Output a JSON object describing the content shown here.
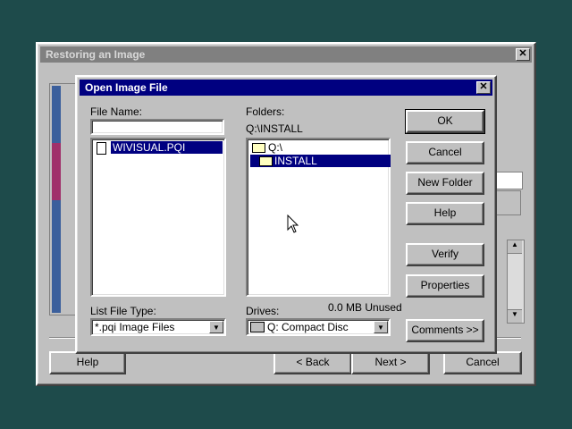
{
  "back_window": {
    "title": "Restoring an Image",
    "buttons": {
      "help": "Help",
      "back": "< Back",
      "next": "Next >",
      "cancel": "Cancel"
    }
  },
  "dialog": {
    "title": "Open Image File",
    "file_name_label": "File Name:",
    "file_name_value": "",
    "files": [
      "WIVISUAL.PQI"
    ],
    "list_file_type_label": "List File Type:",
    "list_file_type_value": "*.pqi  Image Files",
    "folders_label": "Folders:",
    "current_path": "Q:\\INSTALL",
    "folders": [
      "Q:\\",
      "INSTALL"
    ],
    "drives_label": "Drives:",
    "drive_value": "Q:  Compact Disc",
    "unused": "0.0 MB Unused",
    "buttons": {
      "ok": "OK",
      "cancel": "Cancel",
      "new_folder": "New Folder",
      "help": "Help",
      "verify": "Verify",
      "properties": "Properties",
      "comments": "Comments >>"
    }
  },
  "colors": {
    "desktop": "#1e4b4b",
    "active_title": "#000080",
    "inactive_title": "#808080"
  }
}
